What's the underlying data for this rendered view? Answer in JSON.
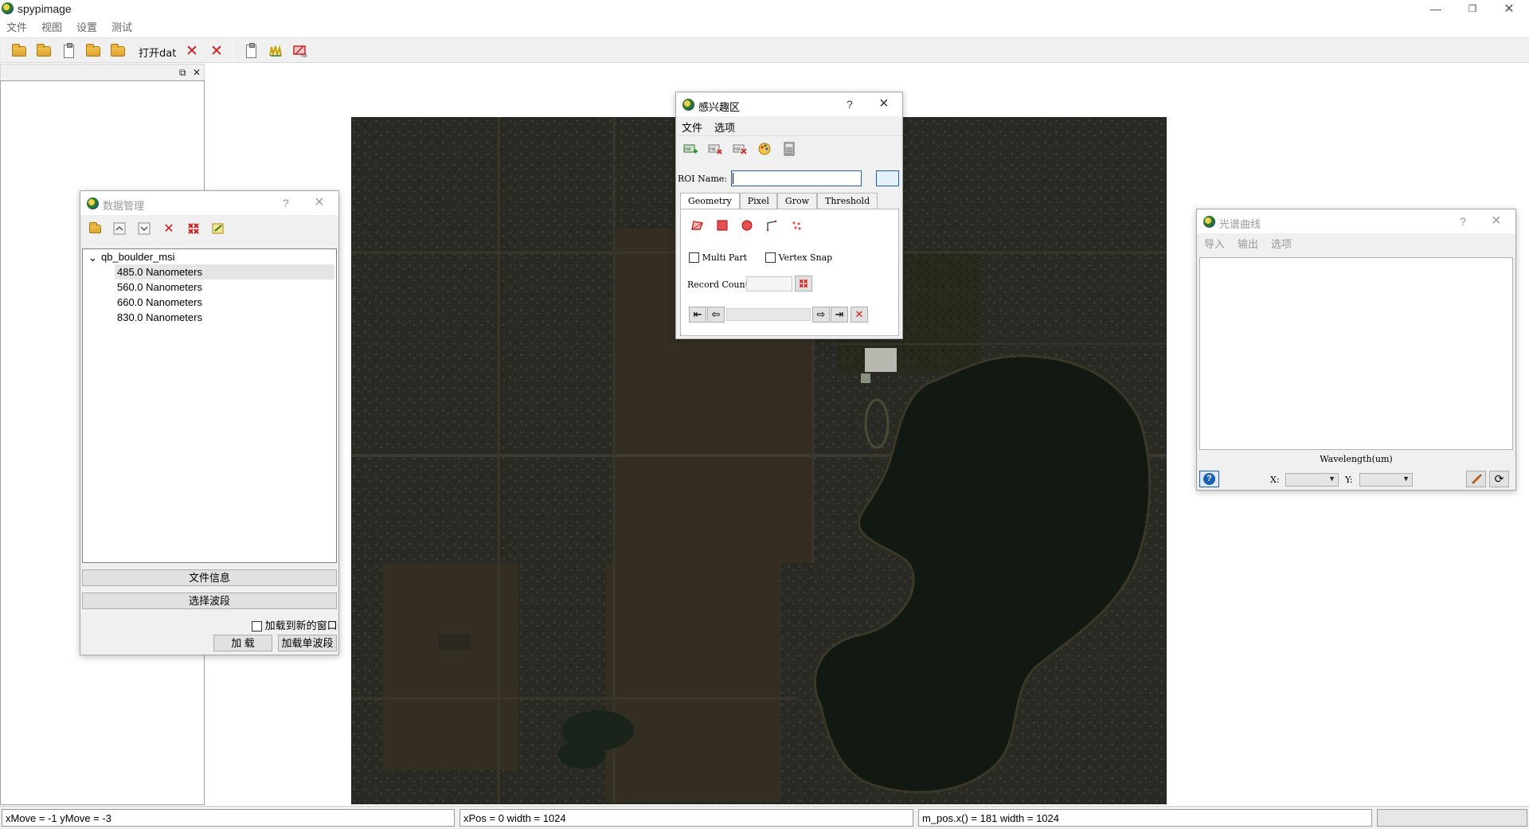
{
  "app": {
    "title": "spypimage"
  },
  "menu": [
    "文件",
    "视图",
    "设置",
    "测试"
  ],
  "toolbar": {
    "open_dat_label": "打开dat"
  },
  "status": {
    "move": "xMove = -1 yMove = -3",
    "pos": "xPos = 0 width = 1024",
    "mpos": "m_pos.x() = 181 width = 1024"
  },
  "data_manager": {
    "title": "数据管理",
    "help": "?",
    "tree_root": "qb_boulder_msi",
    "bands": [
      "485.0 Nanometers",
      "560.0 Nanometers",
      "660.0 Nanometers",
      "830.0 Nanometers"
    ],
    "file_info_button": "文件信息",
    "select_band_button": "选择波段",
    "load_new_window_label": "加载到新的窗口",
    "load_button": "加 载",
    "load_single_band_button": "加载单波段"
  },
  "roi": {
    "title": "感兴趣区",
    "help": "?",
    "menu": [
      "文件",
      "选项"
    ],
    "name_label": "ROI Name:",
    "name_value": "",
    "tabs": [
      "Geometry",
      "Pixel",
      "Grow",
      "Threshold"
    ],
    "multi_part_label": "Multi Part",
    "vertex_snap_label": "Vertex Snap",
    "record_count_label": "Record Count",
    "record_count_value": ""
  },
  "spectral": {
    "title": "光谱曲线",
    "help": "?",
    "menu": [
      "导入",
      "输出",
      "选项"
    ],
    "xlabel": "Wavelength(um)",
    "x_label": "X:",
    "y_label": "Y:",
    "x_value": "",
    "y_value": ""
  },
  "colors": {
    "map_bg": "#2d2a20",
    "lake": "#121812",
    "accent_blue": "#1a5fb4"
  }
}
